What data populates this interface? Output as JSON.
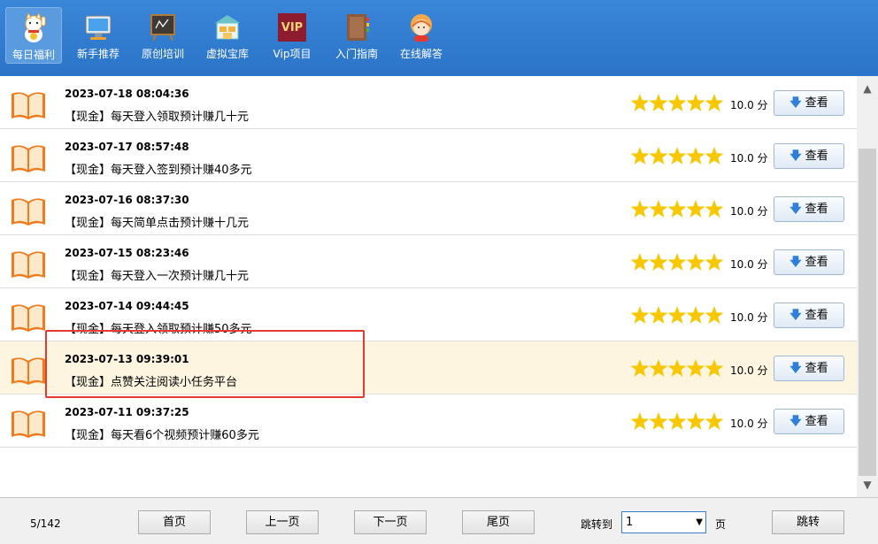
{
  "toolbar": {
    "items": [
      {
        "label": "每日福利",
        "icon": "lucky-cat-icon"
      },
      {
        "label": "新手推荐",
        "icon": "monitor-icon"
      },
      {
        "label": "原创培训",
        "icon": "blackboard-icon"
      },
      {
        "label": "虚拟宝库",
        "icon": "store-icon"
      },
      {
        "label": "Vip项目",
        "icon": "vip-icon"
      },
      {
        "label": "入门指南",
        "icon": "book-icon"
      },
      {
        "label": "在线解答",
        "icon": "support-agent-icon"
      }
    ],
    "vip_badge": "VIP"
  },
  "list": {
    "rows": [
      {
        "date": "2023-07-18 08:04:36",
        "title": "【现金】每天登入领取预计赚几十元",
        "score": "10.0 分",
        "stars": 5,
        "button": "查看"
      },
      {
        "date": "2023-07-17 08:57:48",
        "title": "【现金】每天登入签到预计赚40多元",
        "score": "10.0 分",
        "stars": 5,
        "button": "查看"
      },
      {
        "date": "2023-07-16 08:37:30",
        "title": "【现金】每天简单点击预计赚十几元",
        "score": "10.0 分",
        "stars": 5,
        "button": "查看"
      },
      {
        "date": "2023-07-15 08:23:46",
        "title": "【现金】每天登入一次预计赚几十元",
        "score": "10.0 分",
        "stars": 5,
        "button": "查看"
      },
      {
        "date": "2023-07-14 09:44:45",
        "title": "【现金】每天登入领取预计赚50多元",
        "score": "10.0 分",
        "stars": 5,
        "button": "查看"
      },
      {
        "date": "2023-07-13 09:39:01",
        "title": "【现金】点赞关注阅读小任务平台",
        "score": "10.0 分",
        "stars": 5,
        "button": "查看"
      },
      {
        "date": "2023-07-11 09:37:25",
        "title": "【现金】每天看6个视频预计赚60多元",
        "score": "10.0 分",
        "stars": 5,
        "button": "查看"
      }
    ],
    "highlighted_index": 5
  },
  "pager": {
    "page_info": "5/142",
    "first": "首页",
    "prev": "上一页",
    "next": "下一页",
    "last": "尾页",
    "jump_label": "跳转到",
    "jump_value": "1",
    "page_unit": "页",
    "jump_button": "跳转"
  },
  "colors": {
    "toolbar": "#2b74c8",
    "star": "#f7c800",
    "highlight_row": "#fdf5e0",
    "annotation_box": "#e53a2f",
    "button_arrow": "#2d7fd8"
  }
}
